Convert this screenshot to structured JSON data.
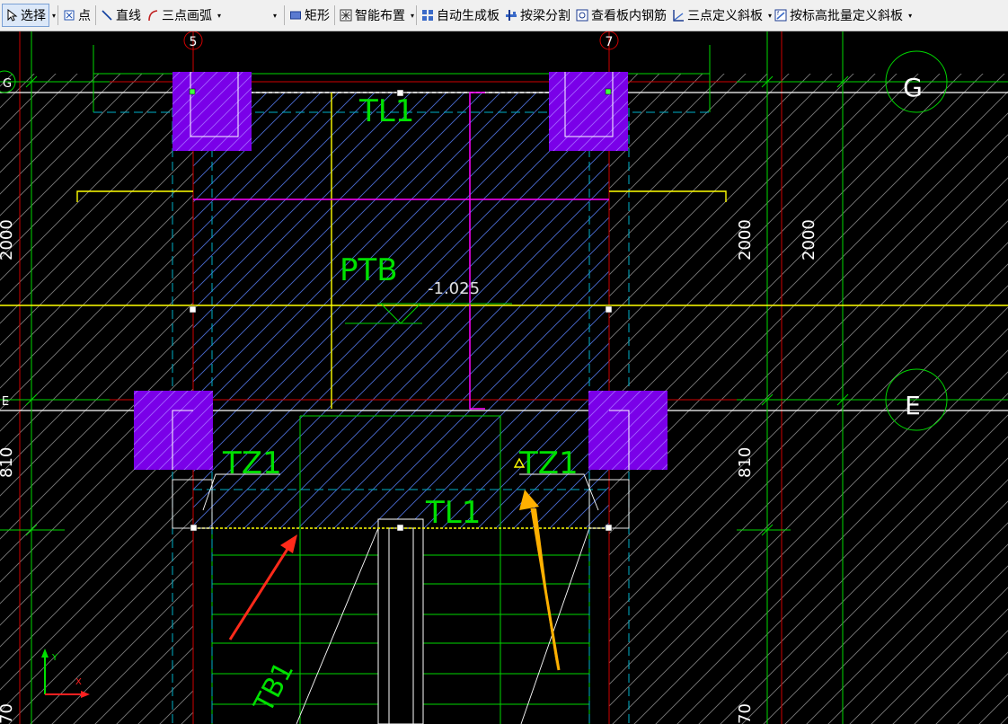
{
  "toolbar": {
    "select": "选择",
    "point": "点",
    "line": "直线",
    "arc3": "三点画弧",
    "rect": "矩形",
    "smart": "智能布置",
    "autoslab": "自动生成板",
    "beamsplit": "按梁分割",
    "viewrebar": "查看板内钢筋",
    "slope3": "三点定义斜板",
    "slopebatch": "按标高批量定义斜板"
  },
  "drawing": {
    "axis5": "5",
    "axis7": "7",
    "axisG": "G",
    "axisE": "E",
    "axisG_left": "G",
    "axisE_left": "E",
    "tl1_top": "TL1",
    "ptb": "PTB",
    "elevation": "-1.025",
    "tz1_left": "TZ1",
    "tz1_right": "TZ1",
    "tl1_bottom": "TL1",
    "tb1": "TB1",
    "dim_2000_left": "2000",
    "dim_2000_mid": "2000",
    "dim_2000_right": "2000",
    "dim_810_left": "810",
    "dim_810_right": "810",
    "dim_70_left": "70",
    "dim_70_right": "70",
    "ucs_x": "X",
    "ucs_y": "Y"
  },
  "colors": {
    "background": "#000000",
    "column": "#7a00e8",
    "grid_green": "#00e000",
    "beam_yellow": "#ffff00",
    "magenta": "#ff00ff",
    "axis_red": "#e00000",
    "cyan": "#00b4c8",
    "hatch_slab": "#4a6ad0",
    "hatch_gray": "#7a7a7a",
    "arrow_red": "#ff2a1a",
    "arrow_orange": "#ffb000"
  }
}
